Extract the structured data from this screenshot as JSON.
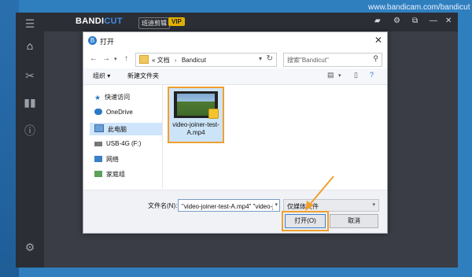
{
  "watermark": "www.bandicam.com/bandicut",
  "app": {
    "brand_main": "BANDI",
    "brand_accent": "CUT",
    "subtitle": "班迪剪辑",
    "vip": "VIP",
    "accent_color": "#3f8ee6",
    "sidebar_icons": [
      "menu-icon",
      "home-icon",
      "cut-icon",
      "join-icon",
      "info-icon",
      "settings-icon"
    ]
  },
  "dialog": {
    "title": "打开",
    "close": "✕",
    "path": [
      "文档",
      "Bandicut"
    ],
    "path_prefix": "«",
    "search_placeholder": "搜索\"Bandicut\"",
    "toolbar": {
      "organize": "组织 ▾",
      "new_folder": "新建文件夹"
    },
    "nav_items": [
      {
        "label": "快速访问",
        "icon": "star-icon"
      },
      {
        "label": "OneDrive",
        "icon": "cloud-icon"
      },
      {
        "label": "此电脑",
        "icon": "pc-icon",
        "selected": true
      },
      {
        "label": "USB-4G (F:)",
        "icon": "usb-icon"
      },
      {
        "label": "网络",
        "icon": "network-icon"
      },
      {
        "label": "家庭组",
        "icon": "homegroup-icon"
      }
    ],
    "file": {
      "name": "video-joiner-test-A.mp4"
    },
    "filename_label": "文件名(N):",
    "filename_value": "\"video-joiner-test-A.mp4\" \"video-j",
    "filetype": "仅媒体文件",
    "open_button": "打开(O)",
    "cancel_button": "取消",
    "highlight_color": "#f0a030"
  }
}
